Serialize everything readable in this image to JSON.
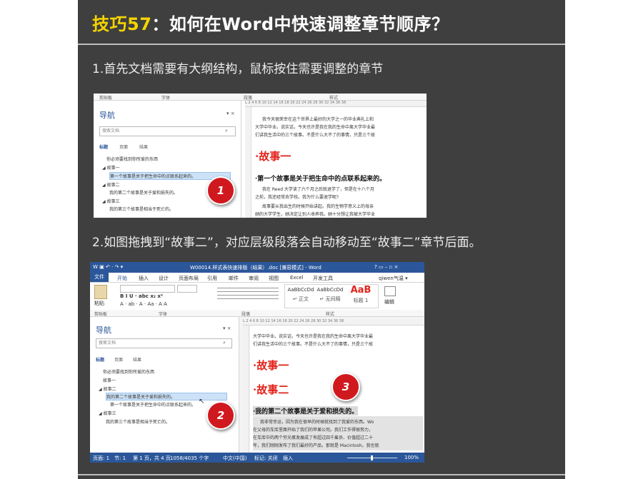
{
  "title": {
    "tip_label": "技巧57",
    "question": "：如何在Word中快速调整章节顺序？"
  },
  "steps": [
    {
      "text": "1.首先文档需要有大纲结构，鼠标按住需要调整的章节"
    },
    {
      "text": "2.如图拖拽到“故事二”，对应层级段落会自动移动至“故事二”章节后面。"
    }
  ],
  "shot1": {
    "group_labels": [
      "剪贴板",
      "字体",
      "段落",
      "样式"
    ],
    "nav": {
      "title": "导航",
      "close": "▾ ×",
      "search_placeholder": "搜索文档",
      "tabs": [
        "标题",
        "页面",
        "结果"
      ],
      "items": [
        "你必须要找到你所爱的东西",
        "◢ 故事一",
        "第一个故事是关于把生命中的点联系起来的。",
        "◢ 故事二",
        "我的第二个故事是关于爱和损失的。",
        "◢ 故事三",
        "我的第三个故事是相当于死亡的。"
      ]
    },
    "ruler": "L 2 4 6 8 10 12 14 16 18 20 22 24 26 28 30 32 34 36 38",
    "doc": {
      "para1": [
        "我今天很荣幸在这个世界上最好的大学之一的毕业典礼上和",
        "大学中毕业。说实话，今天也许是我在我的生命中离大学毕业最",
        "们讲我生活中的三个故事。不是什么大不了的事情，只是三个故"
      ],
      "heading1": "故事一",
      "subheading": "第一个故事是关于把生命中的点联系起来的。",
      "para2": [
        "我在 Reed 大学读了六个月之后就退学了，但是在十八个月",
        "之前，我还经常去学校。我为什么要退学呢?",
        "故事要从我出生的时候开始讲起。我的生物学意义上的母亲",
        "她的大学学生，她决定让别人收养我。她十分想让我被大学毕业"
      ]
    },
    "badge": "1"
  },
  "shot2": {
    "qat": "W ▣ ↶ · ↷ ▾",
    "window_title": "W00014.样式表快速排版（结果）.doc [兼容模式] - Word",
    "window_controls": "? ▭ – ▫ ×",
    "ribbon_tabs": [
      "文件",
      "开始",
      "插入",
      "设计",
      "页面布局",
      "引用",
      "邮件",
      "审阅",
      "视图",
      "Excel",
      "开发工具"
    ],
    "user": "qiwen气温 ▾",
    "paste_label": "粘贴",
    "font_buttons": "B I U · abc x₂ x²",
    "font_buttons2": "A · ab · A · Aa · A A",
    "styles": [
      {
        "preview": "AaBbCcDd",
        "name": "↵ 正文"
      },
      {
        "preview": "AaBbCcDd",
        "name": "↵ 无间隔"
      },
      {
        "preview": "AaB",
        "name": "标题 1"
      }
    ],
    "edit_label": "编辑",
    "group_labels": [
      "剪贴板",
      "字体",
      "段落",
      "样式"
    ],
    "nav": {
      "title": "导航",
      "close": "▾ ×",
      "search_placeholder": "搜索文档",
      "tabs": [
        "标题",
        "页面",
        "结果"
      ],
      "items": [
        "你必须要找到你所爱的东西",
        "故事一",
        "◢ 故事二",
        "我的第二个故事是关于爱和损失的。",
        "第一个故事是关于把生命中的点联系起来的。",
        "◢ 故事三",
        "我的第三个故事是相当于死亡的。"
      ]
    },
    "ruler": "L 2 4 6 8 10 12 14 16 18 20 22 24 26 28 30 32 34 36 38",
    "doc": {
      "para1": [
        "大学中毕业。说实话，今天也许是我在我的生命中离大学毕业最",
        "们讲我生活中的三个故事。不是什么大不了的事情，只是三个故"
      ],
      "heading1": "故事一",
      "heading2": "故事二",
      "subheading": "我的第二个故事是关于爱和损失的。",
      "para2": [
        "我非常幸运，因为我在很早的时候就找到了我爱的东西。Wo",
        "在父母的车库里面开始了我们的苹果公司。我们工作得很努力，",
        "在车库中的两个穷光蛋发展成了有超过四千雇员、价值超过二十",
        "年，我们刚刚发布了我们最好的产品，那就是 Macintosh。我也就"
      ]
    },
    "status": {
      "page": "页面: 1",
      "section": "节: 1",
      "page_of": "第 1 页，共 4 页",
      "words": "1058/4035 个字",
      "lang": "中文(中国)",
      "tag": "标记: 关闭",
      "mode": "插入",
      "zoom": "100%"
    },
    "badge2": "2",
    "badge3": "3"
  },
  "colors": {
    "accent_yellow": "#f5d400",
    "word_blue": "#2b579a",
    "badge_red": "#d0191f",
    "heading_red": "#e2231a"
  }
}
